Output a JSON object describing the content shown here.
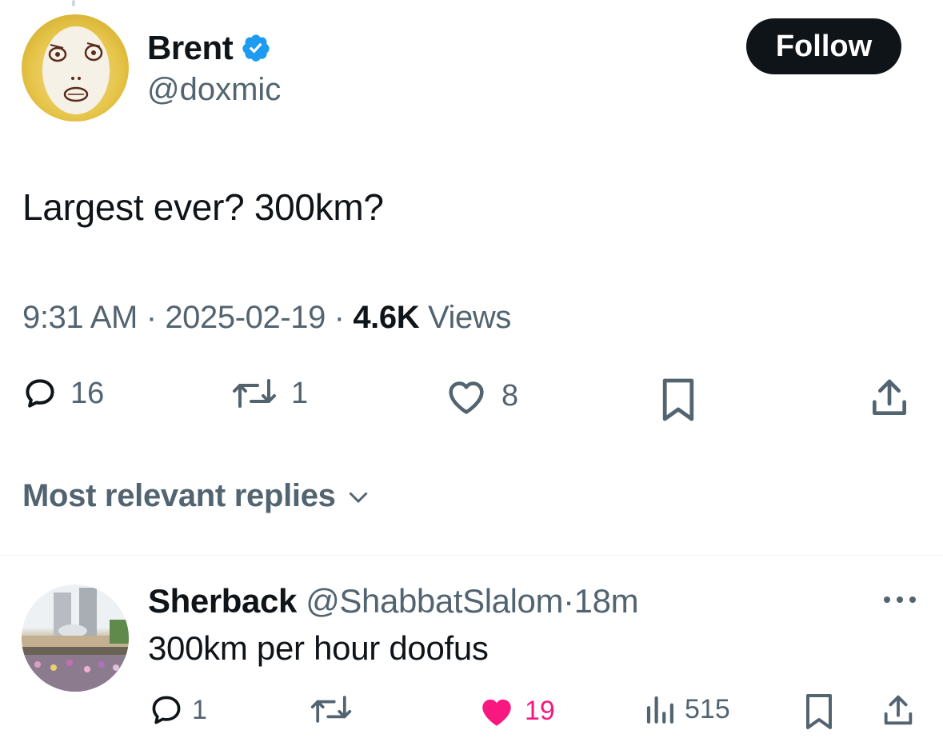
{
  "tweet": {
    "author_name": "Brent",
    "author_handle": "@doxmic",
    "follow_label": "Follow",
    "text": "Largest ever? 300km?",
    "time": "9:31 AM",
    "separator": "·",
    "date": "2025-02-19",
    "views_count": "4.6K",
    "views_label": "Views",
    "stats": {
      "replies": "16",
      "reposts": "1",
      "likes": "8"
    }
  },
  "replies_sort": {
    "label": "Most relevant replies"
  },
  "reply": {
    "author_name": "Sherback",
    "author_handle": "@ShabbatSlalom",
    "separator": "·",
    "time": "18m",
    "text": "300km per hour doofus",
    "stats": {
      "replies": "1",
      "likes": "19",
      "views": "515"
    },
    "liked": true
  },
  "colors": {
    "text": "#0f1419",
    "secondary": "#536471",
    "verified": "#1d9bf0",
    "like": "#f91880",
    "follow_bg": "#0f1419"
  },
  "icons": {
    "verified": "verified-badge-icon",
    "reply": "speech-bubble-icon",
    "repost": "repost-arrows-icon",
    "like": "heart-icon",
    "bookmark": "bookmark-icon",
    "share": "share-upload-icon",
    "views": "bar-chart-icon",
    "more": "more-dots-icon",
    "chevron": "chevron-down-icon"
  }
}
